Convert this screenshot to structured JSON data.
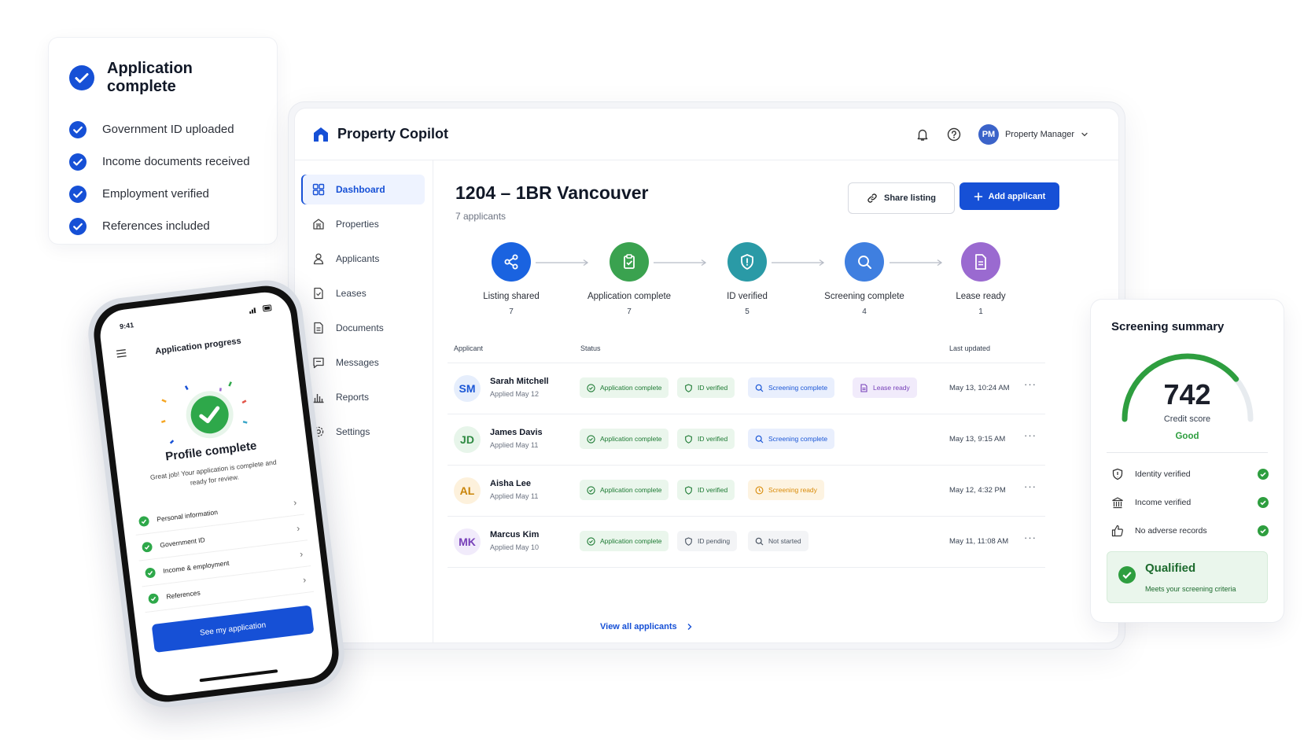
{
  "checklist": {
    "title": "Application complete",
    "items": [
      "Government ID uploaded",
      "Income documents received",
      "Employment verified",
      "References included"
    ]
  },
  "app": {
    "brand": "Property Copilot",
    "user_initials": "PM",
    "user_name": "Property Manager",
    "colors": {
      "accent": "#1650d6",
      "green": "#2e9e3f"
    }
  },
  "sidebar": {
    "items": [
      {
        "label": "Dashboard",
        "icon": "grid-icon",
        "active": true
      },
      {
        "label": "Properties",
        "icon": "building-icon"
      },
      {
        "label": "Applicants",
        "icon": "user-icon"
      },
      {
        "label": "Leases",
        "icon": "file-icon"
      },
      {
        "label": "Documents",
        "icon": "document-icon"
      },
      {
        "label": "Messages",
        "icon": "message-icon"
      },
      {
        "label": "Reports",
        "icon": "bar-chart-icon"
      },
      {
        "label": "Settings",
        "icon": "gear-icon"
      }
    ]
  },
  "listing": {
    "title": "1204 – 1BR Vancouver",
    "subtitle": "7 applicants",
    "share_label": "Share listing",
    "add_label": "Add applicant"
  },
  "pipeline": [
    {
      "label": "Listing shared",
      "count": "7",
      "color": "#1a63e0",
      "icon": "share-icon"
    },
    {
      "label": "Application complete",
      "count": "7",
      "color": "#3aa24f",
      "icon": "clipboard-check-icon"
    },
    {
      "label": "ID verified",
      "count": "5",
      "color": "#2a9aa6",
      "icon": "shield-icon"
    },
    {
      "label": "Screening complete",
      "count": "4",
      "color": "#3f7fe0",
      "icon": "search-icon"
    },
    {
      "label": "Lease ready",
      "count": "1",
      "color": "#9a6ad0",
      "icon": "document-icon"
    }
  ],
  "table": {
    "headers": {
      "applicant": "Applicant",
      "status": "Status",
      "updated": "Last updated"
    },
    "rows": [
      {
        "initials": "SM",
        "name": "Sarah Mitchell",
        "applied": "Applied May 12",
        "updated": "May 13, 10:24 AM",
        "statuses": [
          "Application complete",
          "ID verified",
          "Screening complete",
          "Lease ready"
        ]
      },
      {
        "initials": "JD",
        "name": "James Davis",
        "applied": "Applied May 11",
        "updated": "May 13, 9:15 AM",
        "statuses": [
          "Application complete",
          "ID verified",
          "Screening complete"
        ]
      },
      {
        "initials": "AL",
        "name": "Aisha Lee",
        "applied": "Applied May 11",
        "updated": "May 12, 4:32 PM",
        "statuses": [
          "Application complete",
          "ID verified",
          "Screening ready"
        ]
      },
      {
        "initials": "MK",
        "name": "Marcus Kim",
        "applied": "Applied May 10",
        "updated": "May 11, 11:08 AM",
        "statuses": [
          "Application complete",
          "ID pending",
          "Not started"
        ]
      }
    ],
    "more": "···",
    "view_all": "View all applicants"
  },
  "phone": {
    "time": "9:41",
    "title": "Application progress",
    "heading": "Profile complete",
    "message": "Great job! Your application is complete and ready for review.",
    "items": [
      "Personal information",
      "Government ID",
      "Income & employment",
      "References"
    ],
    "button": "See my application"
  },
  "screening": {
    "title": "Screening summary",
    "score": "742",
    "score_max_fraction": 0.78,
    "score_label": "Credit score",
    "rating": "Good",
    "checks": [
      {
        "label": "Identity verified",
        "icon": "shield-icon"
      },
      {
        "label": "Income verified",
        "icon": "bank-icon"
      },
      {
        "label": "No adverse records",
        "icon": "thumbs-up-icon"
      }
    ],
    "result": "Qualified",
    "result_note": "Meets your screening criteria"
  }
}
